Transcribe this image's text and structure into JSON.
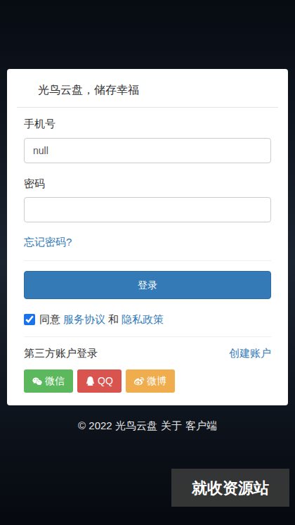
{
  "card": {
    "title": "光鸟云盘，储存幸福"
  },
  "fields": [
    {
      "label": "手机号",
      "value": "null",
      "kind": "text"
    },
    {
      "label": "密码",
      "value": "",
      "kind": "password"
    }
  ],
  "forgot_link": "忘记密码?",
  "login_button": "登录",
  "agreement": {
    "checked": true,
    "parts": [
      {
        "text": "同意",
        "kind": "text"
      },
      {
        "text": "服务协议",
        "kind": "link"
      },
      {
        "text": "和",
        "kind": "text"
      },
      {
        "text": "隐私政策",
        "kind": "link"
      }
    ]
  },
  "third_party": {
    "label": "第三方账户登录",
    "create_account": "创建账户",
    "buttons": [
      {
        "label": "微信",
        "color": "#5cb85c"
      },
      {
        "label": "QQ",
        "color": "#d9534f"
      },
      {
        "label": "微博",
        "color": "#f0ad4e"
      }
    ]
  },
  "footer": [
    "© 2022 光鸟云盘",
    "关于",
    "客户端"
  ],
  "watermark": "就收资源站"
}
